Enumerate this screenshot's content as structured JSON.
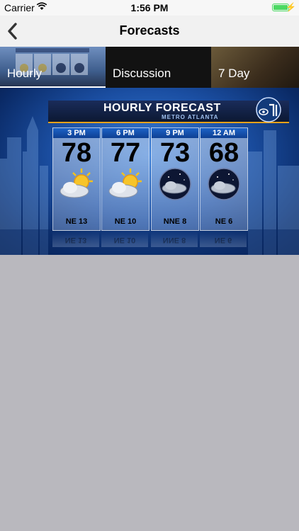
{
  "status": {
    "carrier": "Carrier",
    "time": "1:56 PM"
  },
  "nav": {
    "title": "Forecasts"
  },
  "tabs": [
    {
      "label": "Hourly"
    },
    {
      "label": "Discussion"
    },
    {
      "label": "7 Day"
    }
  ],
  "graphic": {
    "title": "HOURLY FORECAST",
    "subtitle": "METRO ATLANTA",
    "logo": "CBS 46",
    "columns": [
      {
        "time": "3 PM",
        "temp": "78",
        "icon": "partly-sunny",
        "wind": "NE 13"
      },
      {
        "time": "6 PM",
        "temp": "77",
        "icon": "partly-sunny",
        "wind": "NE 10"
      },
      {
        "time": "9 PM",
        "temp": "73",
        "icon": "night-cloudy",
        "wind": "NNE 8"
      },
      {
        "time": "12 AM",
        "temp": "68",
        "icon": "night-cloudy",
        "wind": "NE 6"
      }
    ]
  },
  "colors": {
    "battery": "#4cd964",
    "accent": "#e8a21a"
  }
}
